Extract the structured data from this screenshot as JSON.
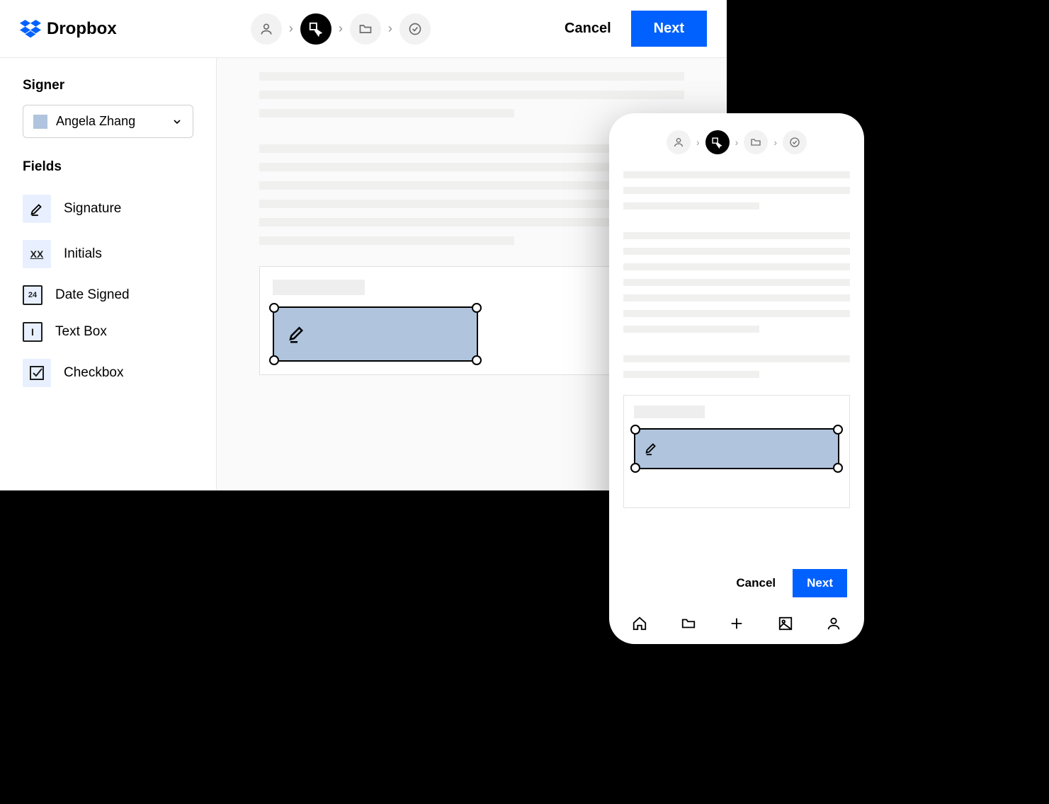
{
  "brand": "Dropbox",
  "header": {
    "cancel_label": "Cancel",
    "next_label": "Next",
    "steps": [
      "person",
      "field",
      "folder",
      "done"
    ],
    "active_step_index": 1
  },
  "sidebar": {
    "signer_label": "Signer",
    "signer_name": "Angela Zhang",
    "signer_color": "#b0c4de",
    "fields_label": "Fields",
    "fields": [
      {
        "icon": "pen-icon",
        "label": "Signature"
      },
      {
        "icon": "initials-icon",
        "label": "Initials",
        "glyph": "XX"
      },
      {
        "icon": "date-icon",
        "label": "Date Signed",
        "glyph": "24"
      },
      {
        "icon": "textbox-icon",
        "label": "Text Box",
        "glyph": "I"
      },
      {
        "icon": "checkbox-icon",
        "label": "Checkbox"
      }
    ]
  },
  "canvas": {
    "placed_field": "signature"
  },
  "mobile": {
    "cancel_label": "Cancel",
    "next_label": "Next",
    "nav_items": [
      "home",
      "folder",
      "add",
      "image",
      "person"
    ]
  }
}
